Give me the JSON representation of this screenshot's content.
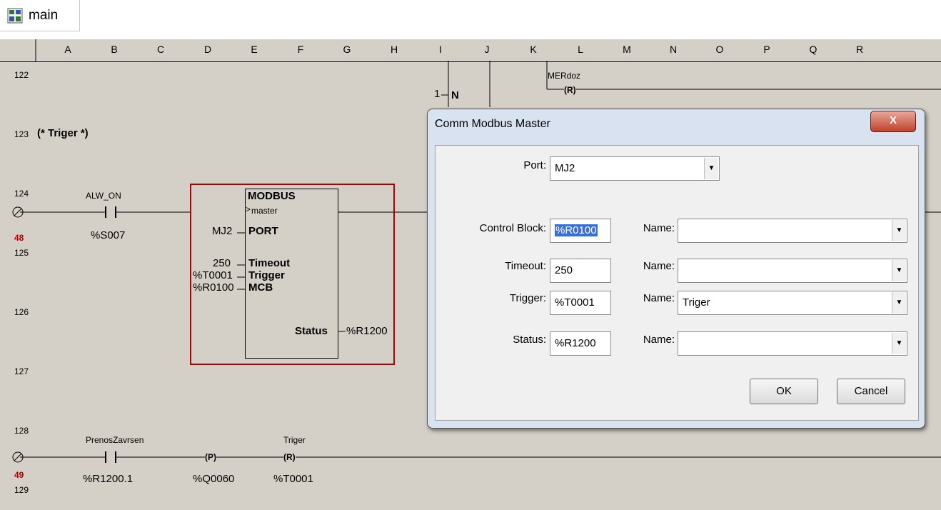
{
  "tab": {
    "label": "main",
    "icon": "ladder-program-icon"
  },
  "columns": [
    "A",
    "B",
    "C",
    "D",
    "E",
    "F",
    "G",
    "H",
    "I",
    "J",
    "K",
    "L",
    "M",
    "N",
    "O",
    "P",
    "Q",
    "R"
  ],
  "rows": {
    "r122": "122",
    "r123": "123",
    "r124": "124",
    "r125": "125",
    "r126": "126",
    "r127": "127",
    "r128": "128",
    "r129": "129",
    "step48": "48",
    "step49": "49"
  },
  "ladder": {
    "comment": "(* Triger *)",
    "contact1_name": "ALW_ON",
    "contact1_addr": "%S007",
    "fb_title": "MODBUS",
    "fb_subtitle": "master",
    "fb_port_in": "MJ2",
    "fb_port_pin": "PORT",
    "fb_timeout_in": "250",
    "fb_timeout_pin": "Timeout",
    "fb_trigger_in": "%T0001",
    "fb_trigger_pin": "Trigger",
    "fb_mcb_in": "%R0100",
    "fb_mcb_pin": "MCB",
    "fb_status_pin": "Status",
    "fb_status_out": "%R1200",
    "top_counter": "1",
    "top_n": "N",
    "top_coil_name": "MERdoz",
    "top_coil_type": "(R)",
    "contact2_name": "PrenosZavrsen",
    "contact2_addr": "%R1200.1",
    "coil_p_type": "(P)",
    "coil_p_addr": "%Q0060",
    "coil_r_name": "Triger",
    "coil_r_type": "(R)",
    "coil_r_addr": "%T0001"
  },
  "dialog": {
    "title": "Comm Modbus Master",
    "close": "X",
    "port_label": "Port:",
    "port_value": "MJ2",
    "control_block_label": "Control Block:",
    "control_block_value": "%R0100",
    "timeout_label": "Timeout:",
    "timeout_value": "250",
    "trigger_label": "Trigger:",
    "trigger_value": "%T0001",
    "status_label": "Status:",
    "status_value": "%R1200",
    "name_label": "Name:",
    "name_control_block": "",
    "name_timeout": "",
    "name_trigger": "Triger",
    "name_status": "",
    "ok": "OK",
    "cancel": "Cancel"
  }
}
